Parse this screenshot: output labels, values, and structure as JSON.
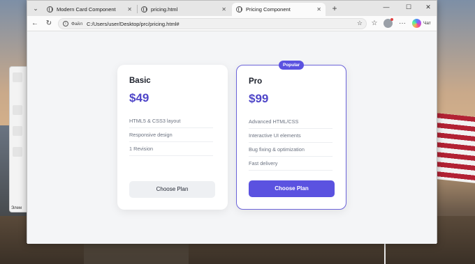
{
  "browser": {
    "tabs": [
      {
        "title": "Modern Card Component",
        "active": false
      },
      {
        "title": "pricing.html",
        "active": false
      },
      {
        "title": "Pricing Component",
        "active": true
      }
    ],
    "address_prefix": "Файл",
    "url": "C:/Users/user/Desktop/prc/pricing.html#",
    "chat_label": "Чат"
  },
  "pricing": {
    "plans": [
      {
        "name": "Basic",
        "price": "$49",
        "features": [
          "HTML5 & CSS3 layout",
          "Responsive design",
          "1 Revision"
        ],
        "button": "Choose Plan"
      },
      {
        "name": "Pro",
        "price": "$99",
        "badge": "Popular",
        "features": [
          "Advanced HTML/CSS",
          "Interactive UI elements",
          "Bug fixing & optimization",
          "Fast delivery"
        ],
        "button": "Choose Plan"
      }
    ]
  },
  "background_window": {
    "label": "Элем"
  },
  "colors": {
    "accent": "#5b52e0",
    "price": "#4f46c8",
    "page_bg": "#f4f5f7"
  }
}
